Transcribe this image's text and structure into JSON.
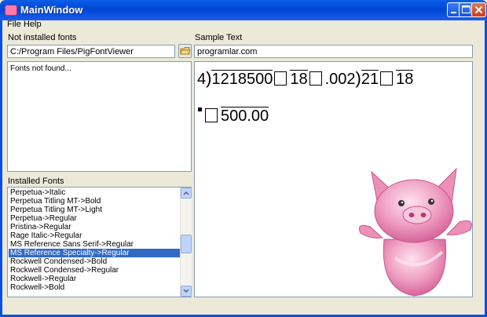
{
  "window": {
    "title": "MainWindow"
  },
  "menu": {
    "file": "File",
    "help": "Help"
  },
  "not_installed": {
    "label": "Not installed fonts",
    "path_value": "C:/Program Files/PigFontViewer",
    "list_text": "Fonts not found..."
  },
  "sample": {
    "label": "Sample Text",
    "input_value": "programlar.com",
    "render": {
      "p1": "4",
      "p2": "1218500",
      "p3": "18",
      "p4": ".002",
      "p5": "21",
      "p6": "18",
      "p7": "500.00"
    }
  },
  "installed": {
    "label": "Installed Fonts",
    "items": [
      "Perpetua->Italic",
      "Perpetua Titling MT->Bold",
      "Perpetua Titling MT->Light",
      "Perpetua->Regular",
      "Pristina->Regular",
      "Rage Italic->Regular",
      "MS Reference Sans Serif->Regular",
      "MS Reference Specialty->Regular",
      "Rockwell Condensed->Bold",
      "Rockwell Condensed->Regular",
      "Rockwell->Regular",
      "Rockwell->Bold"
    ],
    "selected_index": 7
  },
  "colors": {
    "selection": "#316ac5",
    "titlebar": "#0054e3",
    "pig": "#e985b0"
  }
}
